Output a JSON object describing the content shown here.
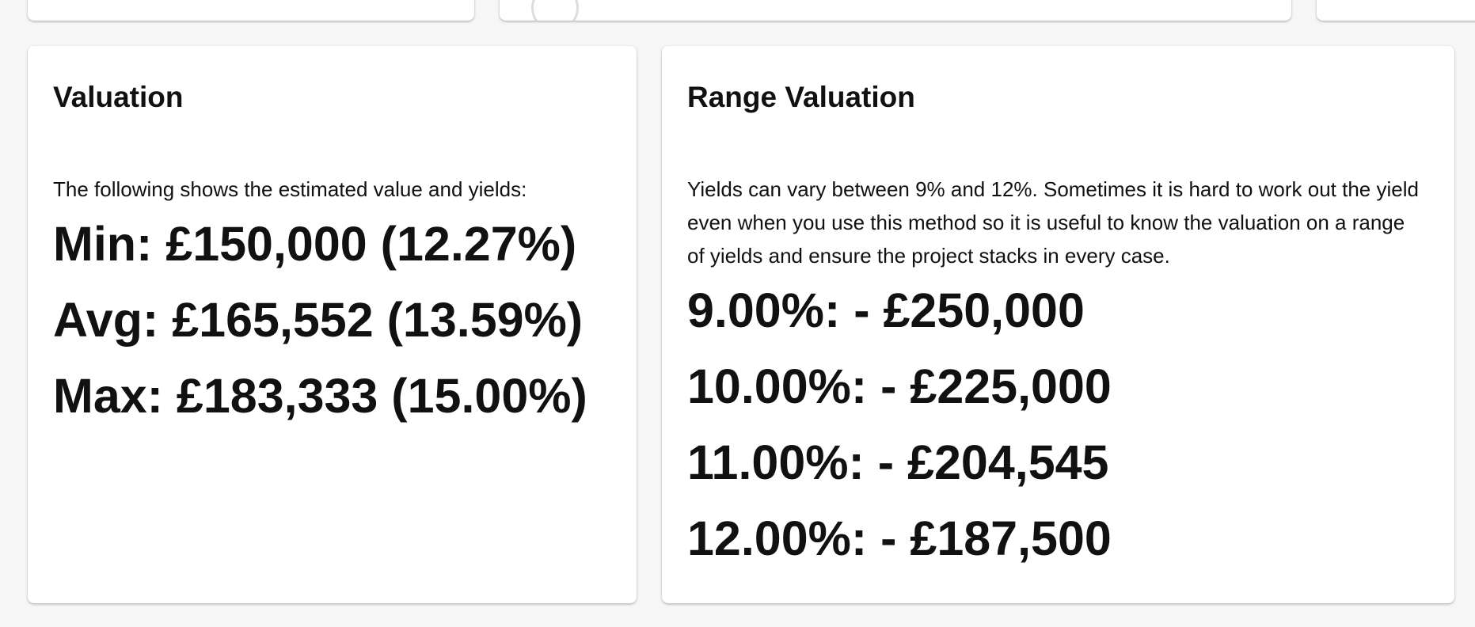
{
  "valuation": {
    "title": "Valuation",
    "description": "The following shows the estimated value and yields:",
    "lines": [
      "Min: £150,000 (12.27%)",
      "Avg: £165,552 (13.59%)",
      "Max: £183,333 (15.00%)"
    ]
  },
  "range_valuation": {
    "title": "Range Valuation",
    "description": "Yields can vary between 9% and 12%. Sometimes it is hard to work out the yield even when you use this method so it is useful to know the valuation on a range of yields and ensure the project stacks in every case.",
    "lines": [
      "9.00%: - £250,000",
      "10.00%: - £225,000",
      "11.00%: - £204,545",
      "12.00%: - £187,500"
    ]
  },
  "colors": {
    "background": "#f6f6f6",
    "card": "#ffffff",
    "text": "#111111"
  }
}
